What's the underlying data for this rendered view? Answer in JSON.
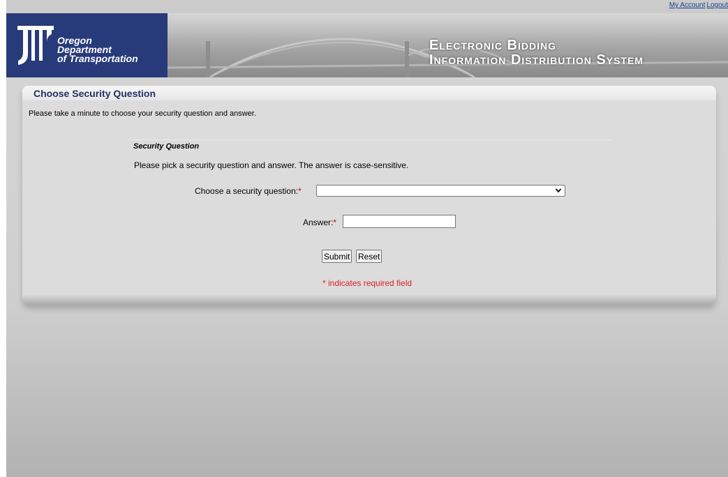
{
  "toplinks": {
    "my_account": "My Account",
    "logout": "Logout"
  },
  "banner": {
    "org_line1": "Oregon",
    "org_line2": "Department",
    "org_line3": "of Transportation",
    "system_line1": "Electronic Bidding",
    "system_line2": "Information Distribution System"
  },
  "panel": {
    "title": "Choose Security Question",
    "intro": "Please take a minute to choose your security question and answer.",
    "section_title": "Security Question",
    "instructions": "Please pick a security question and answer. The answer is case-sensitive."
  },
  "form": {
    "question_label": "Choose a security question:",
    "question_selected": "",
    "answer_label": "Answer:",
    "answer_value": "",
    "required_marker": "*",
    "submit_label": "Submit",
    "reset_label": "Reset",
    "required_note": "* indicates required field"
  },
  "colors": {
    "brand_blue": "#273a7a",
    "title_blue": "#1f3166",
    "required_red": "#e02020",
    "link_blue": "#1a3d8f"
  },
  "icons": {
    "select_arrow": "chevron-down-icon",
    "logo": "odot-logo-icon"
  }
}
